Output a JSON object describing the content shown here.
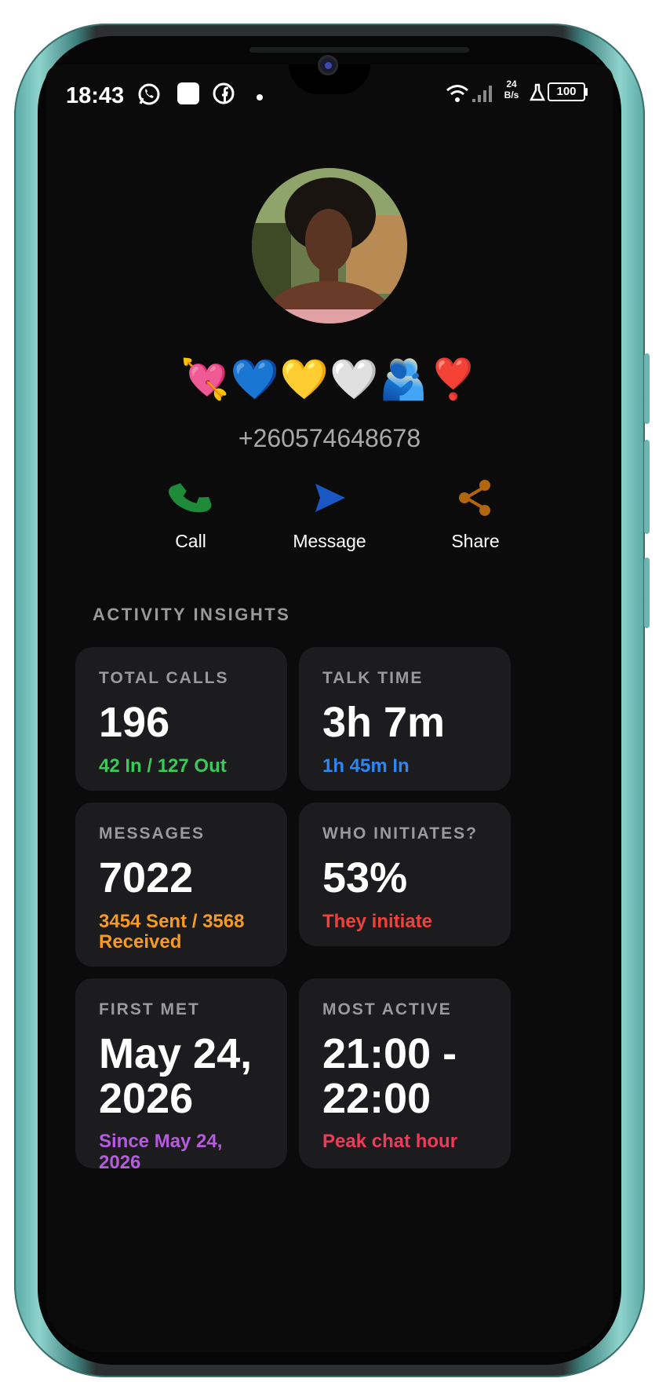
{
  "status_bar": {
    "time": "18:43",
    "network_speed_value": "24",
    "network_speed_unit": "B/s",
    "battery": "100"
  },
  "contact": {
    "name": "💘💙💛🤍🫂❣️",
    "phone": "+260574648678"
  },
  "actions": [
    {
      "label": "Call",
      "icon": "phone-icon",
      "color": "#1e8a3a"
    },
    {
      "label": "Message",
      "icon": "send-icon",
      "color": "#1a56c4"
    },
    {
      "label": "Share",
      "icon": "share-icon",
      "color": "#b3650d"
    }
  ],
  "insights": {
    "title": "ACTIVITY INSIGHTS",
    "cards": [
      {
        "label": "TOTAL CALLS",
        "value": "196",
        "sub": "42 In / 127 Out",
        "sub_color": "#3cc85a"
      },
      {
        "label": "TALK TIME",
        "value": "3h 7m",
        "sub": "1h 45m In",
        "sub_color": "#2f86f0"
      },
      {
        "label": "MESSAGES",
        "value": "7022",
        "sub": "3454 Sent / 3568 Received",
        "sub_color": "#f59a23"
      },
      {
        "label": "WHO INITIATES?",
        "value": "53%",
        "sub": "They initiate",
        "sub_color": "#f0413a"
      },
      {
        "label": "FIRST MET",
        "value": "May 24, 2026",
        "sub": "Since May 24, 2026",
        "sub_color": "#b45be0"
      },
      {
        "label": "MOST ACTIVE",
        "value": "21:00 - 22:00",
        "sub": "Peak chat hour",
        "sub_color": "#f03a5a"
      }
    ]
  }
}
